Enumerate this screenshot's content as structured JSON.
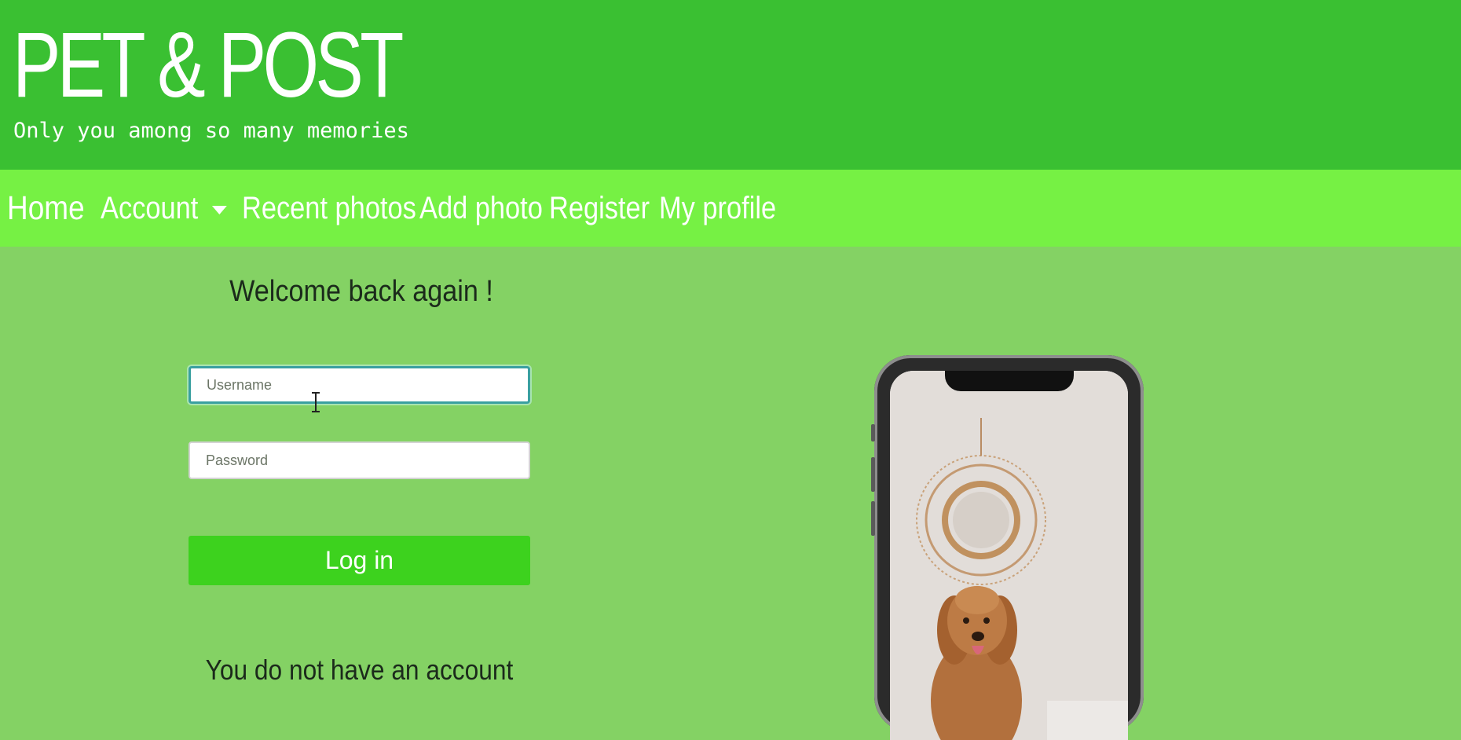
{
  "header": {
    "title": "PET & POST",
    "tagline": "Only you among so many memories"
  },
  "nav": {
    "home": "Home",
    "account": "Account",
    "recent_photos": "Recent photos",
    "add_photo": "Add photo",
    "register": "Register",
    "my_profile": "My profile"
  },
  "login": {
    "heading": "Welcome back again !",
    "username_placeholder": "Username",
    "password_placeholder": "Password",
    "submit_label": "Log in",
    "no_account_text": "You do not have an account"
  },
  "colors": {
    "header_bg": "#3ac032",
    "nav_bg": "#76f144",
    "page_bg": "#84d264",
    "button_bg": "#3dd21e"
  }
}
